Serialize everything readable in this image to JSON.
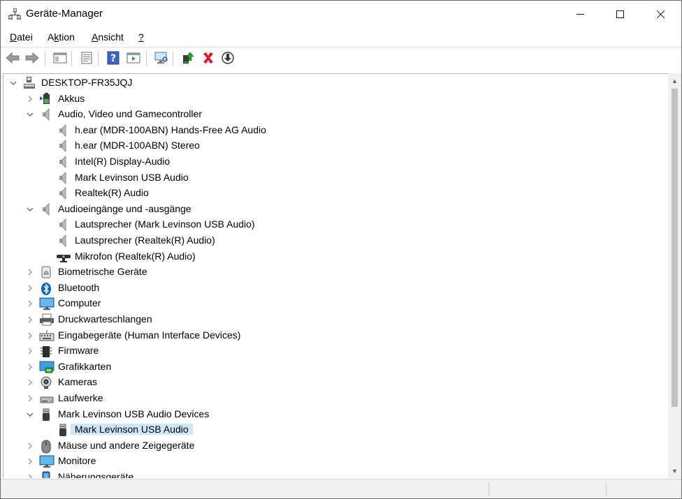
{
  "window": {
    "title": "Geräte-Manager",
    "title_icon": "device-manager-icon"
  },
  "menu": [
    {
      "label": "Datei",
      "underline_index": 0
    },
    {
      "label": "Aktion",
      "underline_index": 1
    },
    {
      "label": "Ansicht",
      "underline_index": 0
    },
    {
      "label": "?",
      "underline_index": 0
    }
  ],
  "toolbar": [
    {
      "icon": "back-arrow-icon"
    },
    {
      "icon": "forward-arrow-icon"
    },
    {
      "icon": "show-hide-console-tree-icon"
    },
    {
      "icon": "properties-icon"
    },
    {
      "icon": "help-icon"
    },
    {
      "icon": "action-pane-icon"
    },
    {
      "icon": "scan-hardware-icon"
    },
    {
      "icon": "update-driver-icon"
    },
    {
      "icon": "uninstall-device-icon"
    },
    {
      "icon": "disable-device-icon"
    }
  ],
  "tree": [
    {
      "label": "DESKTOP-FR35JQJ",
      "level": 0,
      "expand": "expanded",
      "icon": "computer-root-icon"
    },
    {
      "label": "Akkus",
      "level": 1,
      "expand": "collapsed",
      "icon": "battery-icon"
    },
    {
      "label": "Audio, Video und Gamecontroller",
      "level": 1,
      "expand": "expanded",
      "icon": "speaker-icon"
    },
    {
      "label": "h.ear (MDR-100ABN) Hands-Free AG Audio",
      "level": 2,
      "expand": "none",
      "icon": "speaker-icon"
    },
    {
      "label": "h.ear (MDR-100ABN) Stereo",
      "level": 2,
      "expand": "none",
      "icon": "speaker-icon"
    },
    {
      "label": "Intel(R) Display-Audio",
      "level": 2,
      "expand": "none",
      "icon": "speaker-icon"
    },
    {
      "label": "Mark Levinson USB Audio",
      "level": 2,
      "expand": "none",
      "icon": "speaker-icon"
    },
    {
      "label": "Realtek(R) Audio",
      "level": 2,
      "expand": "none",
      "icon": "speaker-icon"
    },
    {
      "label": "Audioeingänge und -ausgänge",
      "level": 1,
      "expand": "expanded",
      "icon": "speaker-icon"
    },
    {
      "label": "Lautsprecher (Mark Levinson USB Audio)",
      "level": 2,
      "expand": "none",
      "icon": "speaker-icon"
    },
    {
      "label": "Lautsprecher (Realtek(R) Audio)",
      "level": 2,
      "expand": "none",
      "icon": "speaker-icon"
    },
    {
      "label": "Mikrofon (Realtek(R) Audio)",
      "level": 2,
      "expand": "none",
      "icon": "microphone-icon"
    },
    {
      "label": "Biometrische Geräte",
      "level": 1,
      "expand": "collapsed",
      "icon": "fingerprint-icon"
    },
    {
      "label": "Bluetooth",
      "level": 1,
      "expand": "collapsed",
      "icon": "bluetooth-icon"
    },
    {
      "label": "Computer",
      "level": 1,
      "expand": "collapsed",
      "icon": "monitor-icon"
    },
    {
      "label": "Druckwarteschlangen",
      "level": 1,
      "expand": "collapsed",
      "icon": "printer-icon"
    },
    {
      "label": "Eingabegeräte (Human Interface Devices)",
      "level": 1,
      "expand": "collapsed",
      "icon": "keyboard-icon"
    },
    {
      "label": "Firmware",
      "level": 1,
      "expand": "collapsed",
      "icon": "chip-icon"
    },
    {
      "label": "Grafikkarten",
      "level": 1,
      "expand": "collapsed",
      "icon": "display-adapter-icon"
    },
    {
      "label": "Kameras",
      "level": 1,
      "expand": "collapsed",
      "icon": "webcam-icon"
    },
    {
      "label": "Laufwerke",
      "level": 1,
      "expand": "collapsed",
      "icon": "drive-icon"
    },
    {
      "label": "Mark Levinson USB Audio Devices",
      "level": 1,
      "expand": "expanded",
      "icon": "usb-icon"
    },
    {
      "label": "Mark Levinson USB Audio",
      "level": 2,
      "expand": "none",
      "icon": "usb-icon",
      "selected": true
    },
    {
      "label": "Mäuse und andere Zeigegeräte",
      "level": 1,
      "expand": "collapsed",
      "icon": "mouse-icon"
    },
    {
      "label": "Monitore",
      "level": 1,
      "expand": "collapsed",
      "icon": "monitor-icon"
    },
    {
      "label": "Näherungsgeräte",
      "level": 1,
      "expand": "collapsed",
      "icon": "proximity-icon"
    }
  ],
  "colors": {
    "selection": "#cce8ff",
    "accent_blue": "#0078d7",
    "uninstall_red": "#e81123",
    "update_green": "#2a9d2a"
  }
}
